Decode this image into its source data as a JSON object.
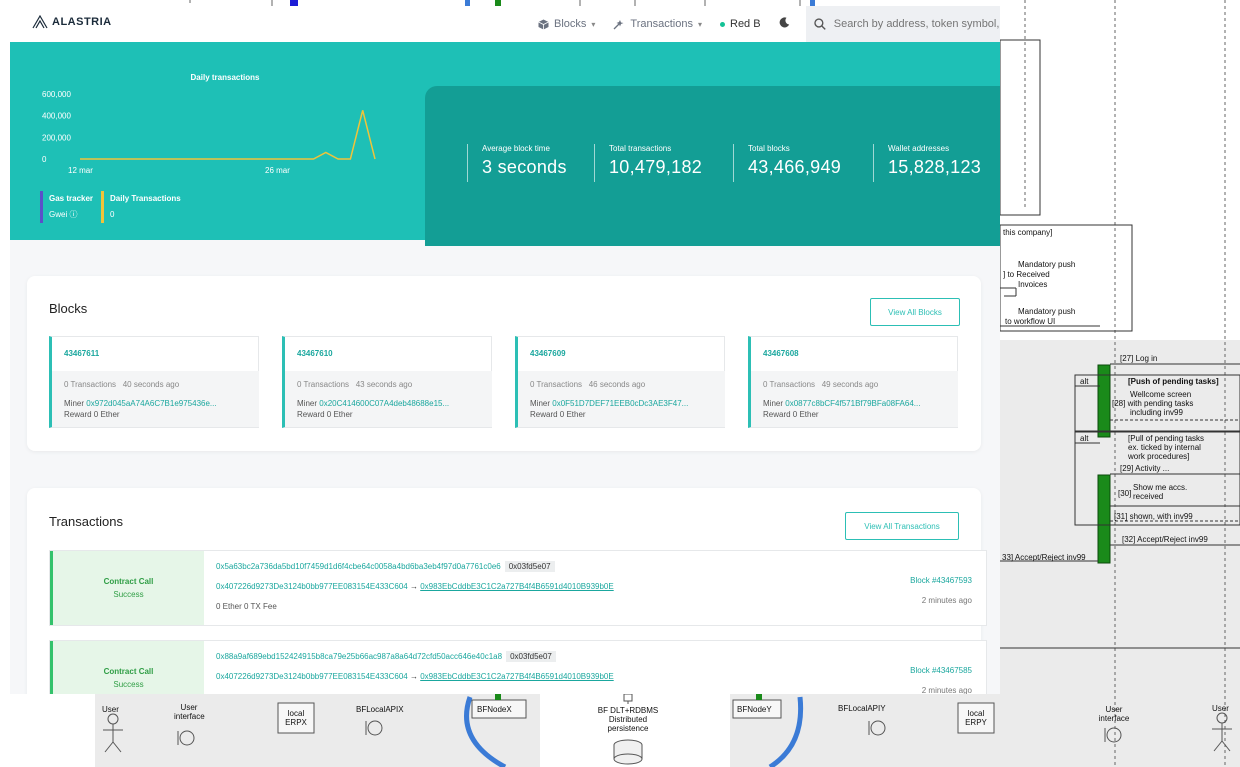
{
  "brand": {
    "name": "ALASTRIA"
  },
  "nav": {
    "blocks": "Blocks",
    "transactions": "Transactions",
    "network": "Red B",
    "search_placeholder": "Search by address, token symbol, n"
  },
  "chart_data": {
    "type": "line",
    "title": "Daily transactions",
    "x_ticks": [
      "12 mar",
      "26 mar"
    ],
    "y_ticks": [
      "600,000",
      "400,000",
      "200,000",
      "0"
    ],
    "ylim": [
      0,
      600000
    ],
    "series": [
      {
        "color": "#f0c43a",
        "values": [
          0,
          0,
          0,
          0,
          0,
          0,
          0,
          0,
          0,
          0,
          0,
          0,
          0,
          0,
          0,
          0,
          0,
          0,
          0,
          0,
          60000,
          0,
          0,
          450000,
          0
        ]
      }
    ]
  },
  "gas": {
    "tracker_label": "Gas tracker",
    "gwei_label": "Gwei",
    "daily_label": "Daily Transactions",
    "daily_value": "0"
  },
  "stats": [
    {
      "label": "Average block time",
      "value": "3 seconds"
    },
    {
      "label": "Total transactions",
      "value": "10,479,182"
    },
    {
      "label": "Total blocks",
      "value": "43,466,949"
    },
    {
      "label": "Wallet addresses",
      "value": "15,828,123"
    }
  ],
  "blocks": {
    "title": "Blocks",
    "view_all": "View All Blocks",
    "items": [
      {
        "number": "43467611",
        "txs": "0 Transactions",
        "age": "40 seconds ago",
        "miner_label": "Miner",
        "miner": "0x972d045aA74A6C7B1e975436e...",
        "reward": "Reward 0 Ether"
      },
      {
        "number": "43467610",
        "txs": "0 Transactions",
        "age": "43 seconds ago",
        "miner_label": "Miner",
        "miner": "0x20C414600C07A4deb48688e15...",
        "reward": "Reward 0 Ether"
      },
      {
        "number": "43467609",
        "txs": "0 Transactions",
        "age": "46 seconds ago",
        "miner_label": "Miner",
        "miner": "0x0F51D7DEF71EEB0cDc3AE3F47...",
        "reward": "Reward 0 Ether"
      },
      {
        "number": "43467608",
        "txs": "0 Transactions",
        "age": "49 seconds ago",
        "miner_label": "Miner",
        "miner": "0x0877c8bCF4f571Bf79BFa08FA64...",
        "reward": "Reward 0 Ether"
      }
    ]
  },
  "transactions": {
    "title": "Transactions",
    "view_all": "View All Transactions",
    "items": [
      {
        "type": "Contract Call",
        "status": "Success",
        "hash": "0x5a63bc2a736da5bd10f7459d1d6f4cbe64c0058a4bd6ba3eb4f97d0a7761c0e6",
        "method": "0x03fd5e07",
        "from": "0x407226d9273De3124b0bb977EE083154E433C604",
        "arrow": "→",
        "to": "0x983EbCddbE3C1C2a727B4f4B6591d4010B939b0E",
        "fee": "0 Ether 0 TX Fee",
        "block": "Block #43467593",
        "age": "2 minutes ago"
      },
      {
        "type": "Contract Call",
        "status": "Success",
        "hash": "0x88a9af689ebd152424915b8ca79e25b66ac987a8a64d72cfd50acc646e40c1a8",
        "method": "0x03fd5e07",
        "from": "0x407226d9273De3124b0bb977EE083154E433C604",
        "arrow": "→",
        "to": "0x983EbCddbE3C1C2a727B4f4B6591d4010B939b0E",
        "fee": "",
        "block": "Block #43467585",
        "age": "2 minutes ago"
      }
    ]
  },
  "diagram": {
    "company_label": "this company]",
    "mandatory_push_1": "Mandatory push",
    "to_received": "] to Received",
    "invoices": "Invoices",
    "mandatory_push_2": "Mandatory push",
    "to_workflow": "to workflow UI",
    "log_in": "[27] Log in",
    "alt1": "alt",
    "push_pending": "[Push of pending tasks]",
    "welcome_screen": "Wellcome screen",
    "with_pending": "[28] with pending tasks",
    "including_inv99": "including inv99",
    "alt2": "alt",
    "pull_pending": "[Pull of pending tasks",
    "ex_ticked": "ex. ticked by internal",
    "work_procedures": "work procedures]",
    "activity": "[29] Activity ...",
    "show_me_num": "[30]",
    "show_me": "Show me accs.",
    "received": "received",
    "shown_inv99": "[31] shown, with inv99",
    "accept_reject_32": "[32] Accept/Reject inv99",
    "accept_reject_33": "33] Accept/Reject inv99",
    "user_left": "User",
    "user_interface_left_1": "User",
    "user_interface_left_2": "interface",
    "local_erpx_1": "local",
    "local_erpx_2": "ERPX",
    "bflocalapix": "BFLocalAPIX",
    "bfnodex": "BFNodeX",
    "bf_dlt_1": "BF DLT+RDBMS",
    "bf_dlt_2": "Distributed",
    "bf_dlt_3": "persistence",
    "bfnodey": "BFNodeY",
    "bflocalapiy": "BFLocalAPIY",
    "local_erpy_1": "local",
    "local_erpy_2": "ERPY",
    "user_interface_right_1": "User",
    "user_interface_right_2": "interface",
    "user_right": "User"
  }
}
